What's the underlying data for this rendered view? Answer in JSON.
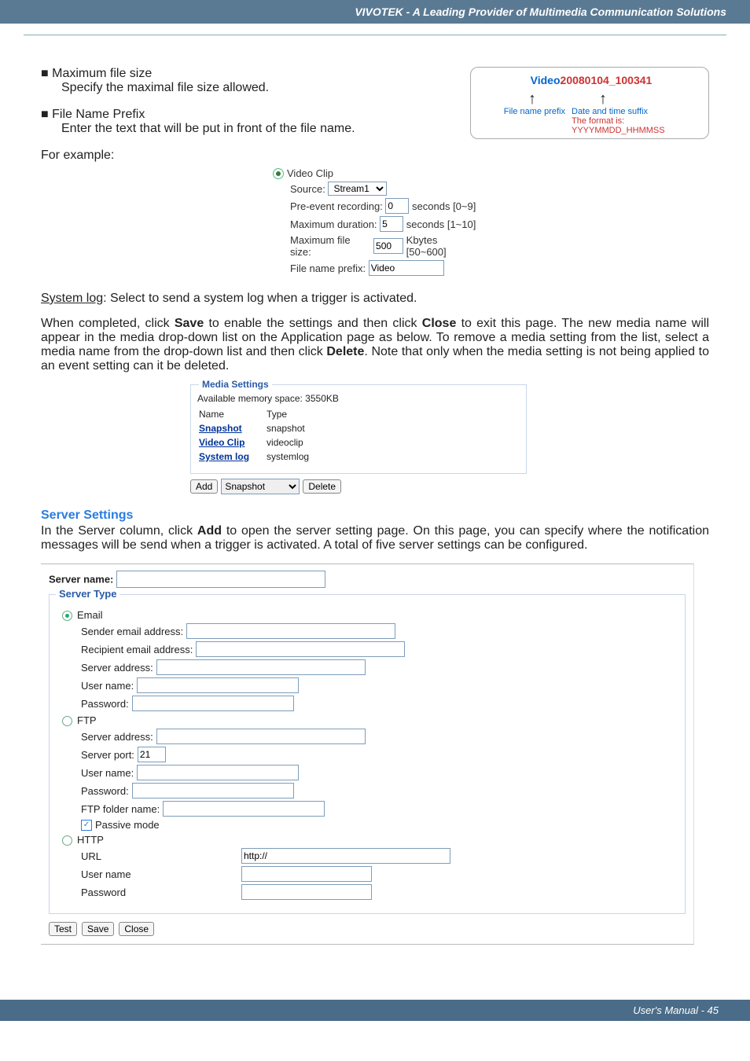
{
  "header": "VIVOTEK - A Leading Provider of Multimedia Communication Solutions",
  "bullets": {
    "b1_title": "■ Maximum file size",
    "b1_desc": "Specify the maximal file size allowed.",
    "b2_title": "■ File Name Prefix",
    "b2_desc": "Enter the text that will be put in front of the file name."
  },
  "example": {
    "for_example": "For example:",
    "prefix": "Video",
    "suffix": "20080104_100341",
    "caption_prefix": "File name prefix",
    "caption_suffix": "Date and time suffix",
    "caption_format": "The format is: YYYYMMDD_HHMMSS"
  },
  "clip": {
    "title": "Video Clip",
    "source_lbl": "Source:",
    "source_val": "Stream1",
    "pre_lbl": "Pre-event recording:",
    "pre_val": "0",
    "pre_unit": "seconds [0~9]",
    "dur_lbl": "Maximum duration:",
    "dur_val": "5",
    "dur_unit": "seconds [1~10]",
    "size_lbl": "Maximum file size:",
    "size_val": "500",
    "size_unit": "Kbytes [50~600]",
    "prefix_lbl": "File name prefix:",
    "prefix_val": "Video"
  },
  "syslog_line": {
    "label": "System log",
    "text": ": Select to send a system log when a trigger is activated."
  },
  "para1_a": "When completed, click ",
  "para1_save": "Save",
  "para1_b": " to enable the settings and then click ",
  "para1_close": "Close",
  "para1_c": " to exit this page. The new media name will appear in the media drop-down list on the Application page as below. To remove a media setting from the list, select a media name from the drop-down list and then click ",
  "para1_delete": "Delete",
  "para1_d": ". Note that only when the media setting is not being applied to an event setting can it be deleted.",
  "media_box": {
    "legend": "Media Settings",
    "avail": "Available memory space: 3550KB",
    "col_name": "Name",
    "col_type": "Type",
    "rows": [
      {
        "name": "Snapshot",
        "type": "snapshot"
      },
      {
        "name": "Video Clip",
        "type": "videoclip"
      },
      {
        "name": "System log",
        "type": "systemlog"
      }
    ],
    "add_btn": "Add",
    "select_val": "Snapshot",
    "delete_btn": "Delete"
  },
  "server_heading": "Server Settings",
  "server_para_a": "In the Server column, click ",
  "server_para_add": "Add",
  "server_para_b": " to open the server setting page. On this page, you can specify where the notification messages will be send when a trigger is activated. A total of five server settings can be configured.",
  "server_form": {
    "server_name_lbl": "Server name:",
    "legend": "Server Type",
    "email": "Email",
    "sender_lbl": "Sender email address:",
    "recipient_lbl": "Recipient email address:",
    "srv_addr_lbl": "Server address:",
    "user_lbl": "User name:",
    "pass_lbl": "Password:",
    "ftp": "FTP",
    "ftp_addr_lbl": "Server address:",
    "ftp_port_lbl": "Server port:",
    "ftp_port_val": "21",
    "ftp_user_lbl": "User name:",
    "ftp_pass_lbl": "Password:",
    "ftp_folder_lbl": "FTP folder name:",
    "passive_lbl": "Passive mode",
    "http": "HTTP",
    "url_lbl": "URL",
    "url_val": "http://",
    "http_user_lbl": "User name",
    "http_pass_lbl": "Password",
    "test_btn": "Test",
    "save_btn": "Save",
    "close_btn": "Close"
  },
  "footer": "User's Manual - 45"
}
